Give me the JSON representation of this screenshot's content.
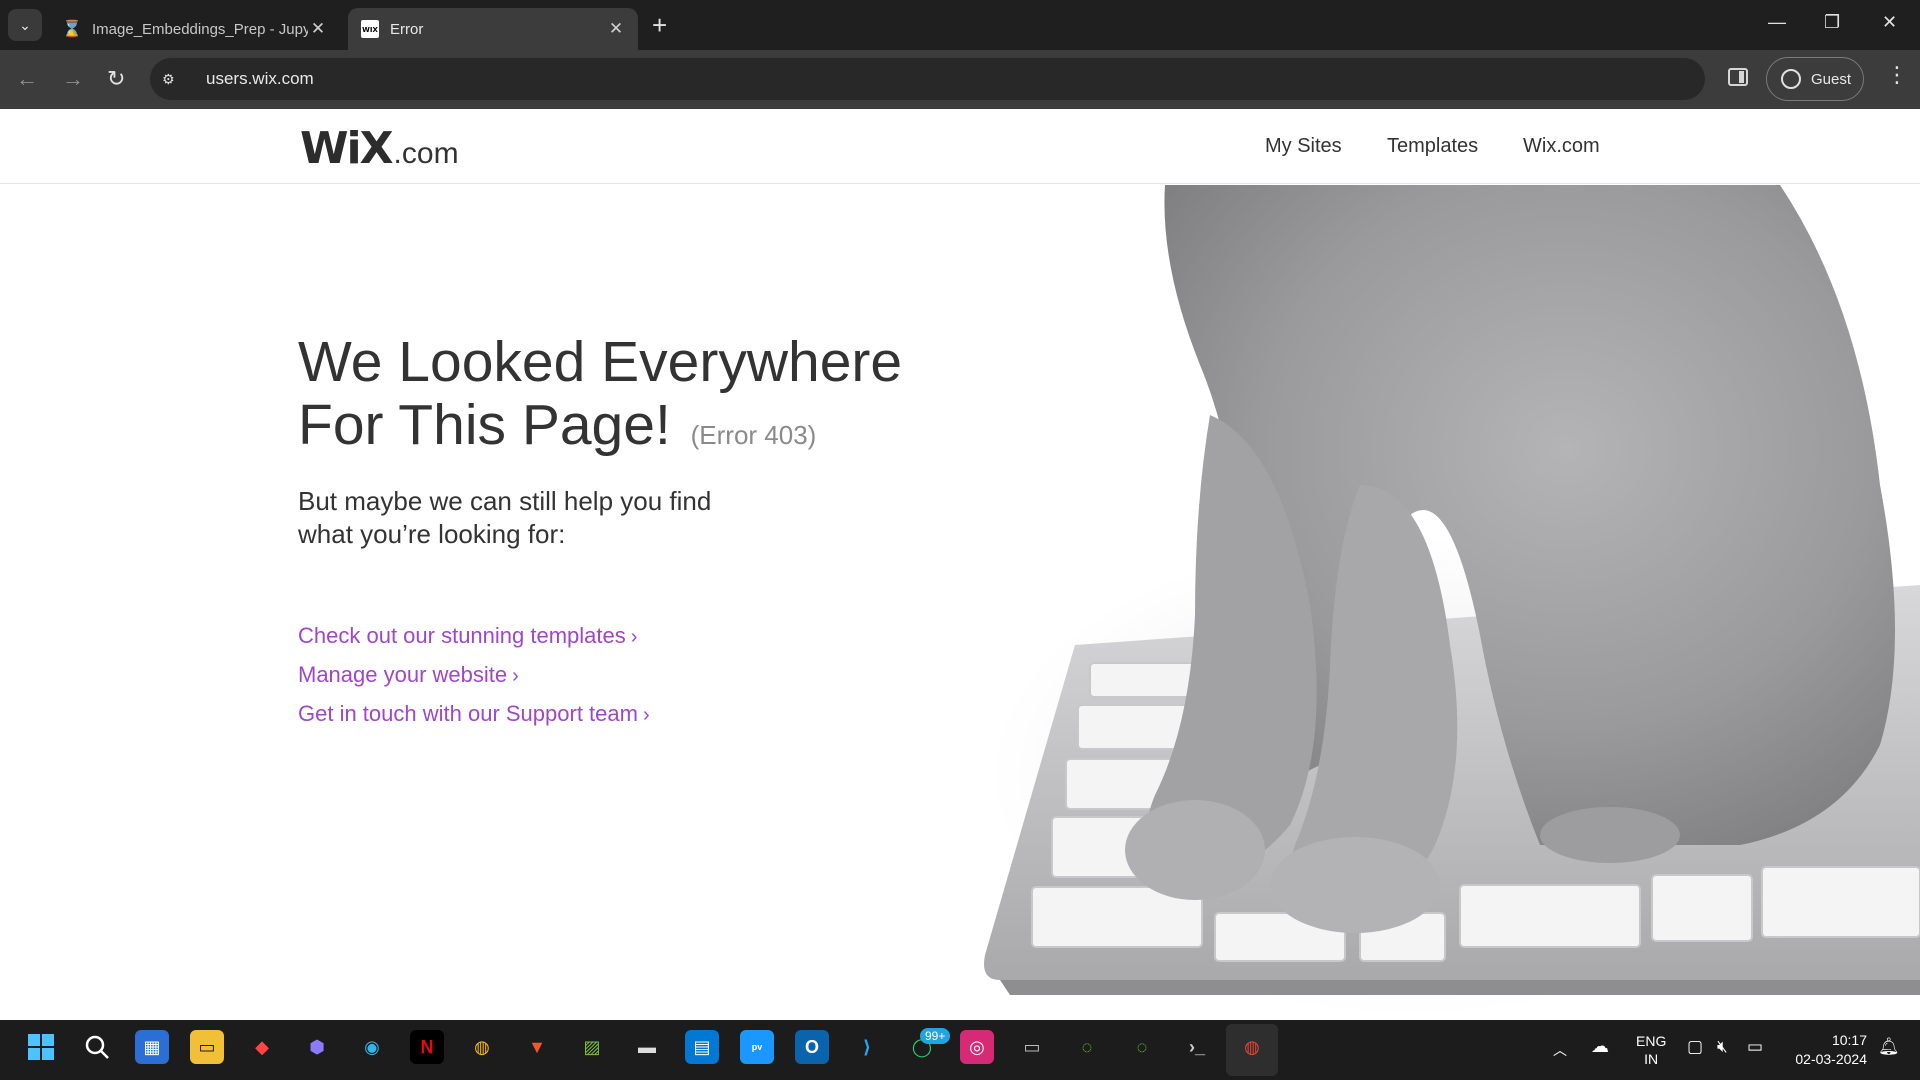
{
  "browser": {
    "tabs": [
      {
        "title": "Image_Embeddings_Prep - Jupyter",
        "icon": "hourglass-icon",
        "active": false
      },
      {
        "title": "Error",
        "icon": "wix-favicon",
        "active": true
      }
    ],
    "url": "users.wix.com",
    "profile_label": "Guest"
  },
  "site": {
    "logo_main": "WiX",
    "logo_suffix": ".com",
    "nav": [
      "My Sites",
      "Templates",
      "Wix.com"
    ]
  },
  "error": {
    "headline_line1": "We Looked Everywhere",
    "headline_line2": "For This Page!",
    "code": "(Error 403)",
    "subtext_line1": "But maybe we can still help you find",
    "subtext_line2": "what you’re looking for:",
    "links": [
      "Check out our stunning templates",
      "Manage your website",
      "Get in touch with our Support team"
    ],
    "link_color": "#a046c8"
  },
  "taskbar": {
    "badge": "99+",
    "language_line1": "ENG",
    "language_line2": "IN",
    "time": "10:17",
    "date": "02-03-2024"
  }
}
